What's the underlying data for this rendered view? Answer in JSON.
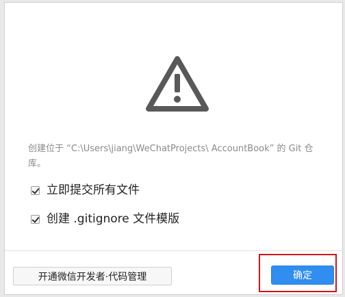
{
  "dialog": {
    "icon": "warning-triangle-icon",
    "description": "创建位于 “C:\\Users\\jiang\\WeChatProjects\\ AccountBook” 的 Git 仓库。",
    "options": [
      {
        "label": "立即提交所有文件",
        "checked": true
      },
      {
        "label": "创建 .gitignore 文件模版",
        "checked": true
      }
    ],
    "footer": {
      "secondary_button": "开通微信开发者·代码管理",
      "primary_button": "确定"
    }
  },
  "colors": {
    "primary": "#2f8ef0",
    "highlight": "#d0121b",
    "icon": "#595959"
  }
}
